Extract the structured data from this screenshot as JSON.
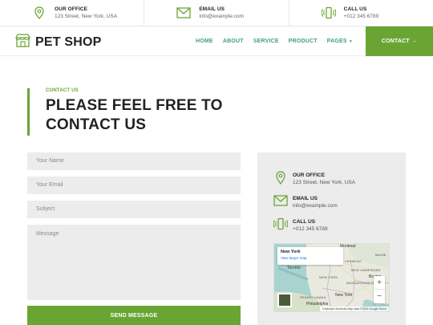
{
  "topbar": {
    "office": {
      "title": "OUR OFFICE",
      "value": "123 Street, New York, USA",
      "icon": "map-pin-icon"
    },
    "email": {
      "title": "EMAIL US",
      "value": "info@example.com",
      "icon": "envelope-icon"
    },
    "call": {
      "title": "CALL US",
      "value": "+012 345 6789",
      "icon": "phone-icon"
    }
  },
  "brand": {
    "name": "PET SHOP",
    "icon": "shop-icon",
    "accent": "#6aa534",
    "nav_color": "#3fa27a"
  },
  "nav": {
    "items": [
      "HOME",
      "ABOUT",
      "SERVICE",
      "PRODUCT",
      "PAGES"
    ],
    "cta": "CONTACT →"
  },
  "heading": {
    "kicker": "CONTACT US",
    "line1": "PLEASE FEEL FREE TO",
    "line2": "CONTACT US"
  },
  "form": {
    "name_placeholder": "Your Name",
    "email_placeholder": "Your Email",
    "subject_placeholder": "Subject",
    "message_placeholder": "Message",
    "submit": "SEND MESSAGE"
  },
  "info": {
    "office": {
      "title": "OUR OFFICE",
      "value": "123 Street, New York, USA"
    },
    "email": {
      "title": "EMAIL US",
      "value": "info@example.com"
    },
    "call": {
      "title": "CALL US",
      "value": "+012 345 6789"
    }
  },
  "map": {
    "place": "New York",
    "link": "View larger map",
    "labels": [
      "Montreal",
      "VERMONT",
      "MAINE",
      "NEW HAMPSHIRE",
      "MASSACHUSETTS",
      "NEW YORK",
      "PENNSYLVANIA",
      "Philadelphia",
      "New York",
      "Toronto",
      "Boston"
    ],
    "zoom_in": "+",
    "zoom_out": "−",
    "attribution": "Keyboard shortcuts   Map data ©2024 Google   Terms"
  }
}
